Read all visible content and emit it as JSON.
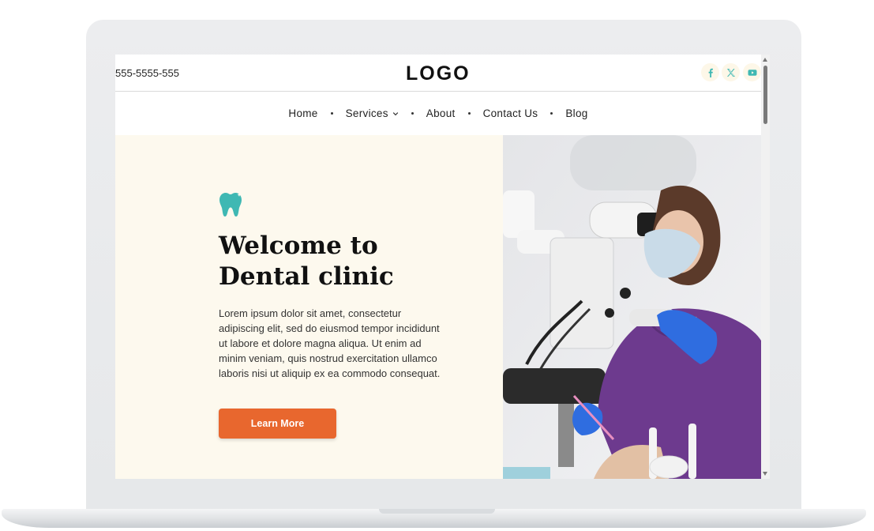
{
  "header": {
    "phone": "555-5555-555",
    "logo": "LOGO",
    "social_icons": [
      "facebook-icon",
      "x-icon",
      "youtube-icon"
    ]
  },
  "nav": {
    "items": [
      {
        "label": "Home"
      },
      {
        "label": "Services",
        "has_dropdown": true
      },
      {
        "label": "About"
      },
      {
        "label": "Contact Us"
      },
      {
        "label": "Blog"
      }
    ]
  },
  "hero": {
    "icon": "tooth-icon",
    "title": "Welcome to Dental clinic",
    "text": "Lorem ipsum dolor sit amet, consectetur adipiscing elit, sed do eiusmod tempor incididunt ut labore et dolore magna aliqua. Ut enim ad minim veniam, quis nostrud exercitation ullamco laboris nisi ut aliquip ex ea commodo consequat.",
    "button_label": "Learn More",
    "image": "dentist-photo"
  },
  "colors": {
    "accent": "#e8672e",
    "teal": "#3fb8b3",
    "hero_bg": "#fdf9ee",
    "scrub_purple": "#6d3a8e"
  }
}
